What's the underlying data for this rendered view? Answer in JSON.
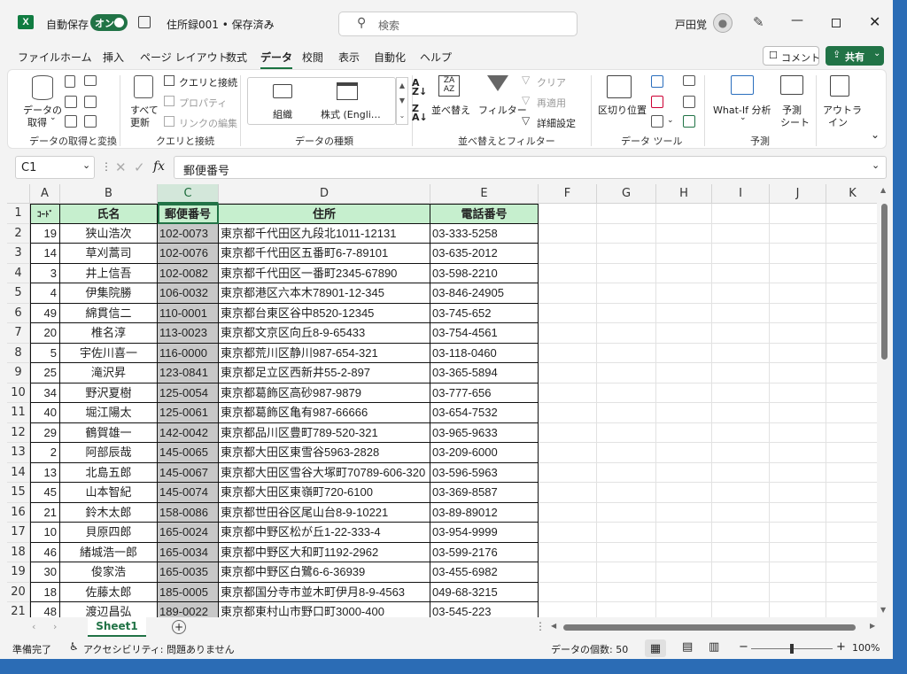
{
  "titlebar": {
    "autosave_label": "自動保存",
    "autosave_state": "オン",
    "filename": "住所録001 • 保存済み",
    "search_placeholder": "検索",
    "user_name": "戸田覚"
  },
  "menu": [
    "ファイル",
    "ホーム",
    "挿入",
    "ページ レイアウト",
    "数式",
    "データ",
    "校閲",
    "表示",
    "自動化",
    "ヘルプ"
  ],
  "menu_active": "データ",
  "comment_label": "コメント",
  "share_label": "共有",
  "ribbon": {
    "get_data": {
      "line1": "データの",
      "line2": "取得"
    },
    "refresh_all": {
      "line1": "すべて",
      "line2": "更新"
    },
    "queries_connections": "クエリと接続",
    "properties": "プロパティ",
    "edit_links": "リンクの編集",
    "org": "組織",
    "stocks": "株式 (Engli…",
    "sort_label": "並べ替え",
    "filter_label": "フィルター",
    "clear_label": "クリア",
    "reapply_label": "再適用",
    "advanced_label": "詳細設定",
    "text_to_columns": "区切り位置",
    "whatif_label": "What-If 分析",
    "forecast": {
      "line1": "予測",
      "line2": "シート"
    },
    "outline": {
      "line1": "アウトラ",
      "line2": "イン"
    },
    "groups": [
      "データの取得と変換",
      "クエリと接続",
      "データの種類",
      "並べ替えとフィルター",
      "データ ツール",
      "予測"
    ]
  },
  "formula_bar": {
    "name_box": "C1",
    "fx": "fx",
    "content": "郵便番号"
  },
  "columns": [
    "A",
    "B",
    "C",
    "D",
    "E",
    "F",
    "G",
    "H",
    "I",
    "J",
    "K"
  ],
  "selected_column": "C",
  "table": {
    "headers": [
      "ｺｰﾄﾞ",
      "氏名",
      "郵便番号",
      "住所",
      "電話番号"
    ],
    "rows": [
      [
        "19",
        "狭山浩次",
        "102-0073",
        "東京都千代田区九段北1011-12131",
        "03-333-5258"
      ],
      [
        "14",
        "草刈蒿司",
        "102-0076",
        "東京都千代田区五番町6-7-89101",
        "03-635-2012"
      ],
      [
        "3",
        "井上信吾",
        "102-0082",
        "東京都千代田区一番町2345-67890",
        "03-598-2210"
      ],
      [
        "4",
        "伊集院勝",
        "106-0032",
        "東京都港区六本木78901-12-345",
        "03-846-24905"
      ],
      [
        "49",
        "綿貫信二",
        "110-0001",
        "東京都台東区谷中8520-12345",
        "03-745-652"
      ],
      [
        "20",
        "椎名淳",
        "113-0023",
        "東京都文京区向丘8-9-65433",
        "03-754-4561"
      ],
      [
        "5",
        "宇佐川喜一",
        "116-0000",
        "東京都荒川区静川987-654-321",
        "03-118-0460"
      ],
      [
        "25",
        "滝沢昇",
        "123-0841",
        "東京都足立区西新井55-2-897",
        "03-365-5894"
      ],
      [
        "34",
        "野沢夏樹",
        "125-0054",
        "東京都葛飾区高砂987-9879",
        "03-777-656"
      ],
      [
        "40",
        "堀江陽太",
        "125-0061",
        "東京都葛飾区亀有987-66666",
        "03-654-7532"
      ],
      [
        "29",
        "鶴賀雄一",
        "142-0042",
        "東京都品川区豊町789-520-321",
        "03-965-9633"
      ],
      [
        "2",
        "阿部辰哉",
        "145-0065",
        "東京都大田区東雪谷5963-2828",
        "03-209-6000"
      ],
      [
        "13",
        "北島五郎",
        "145-0067",
        "東京都大田区雪谷大塚町70789-606-320",
        "03-596-5963"
      ],
      [
        "45",
        "山本智紀",
        "145-0074",
        "東京都大田区東嶺町720-6100",
        "03-369-8587"
      ],
      [
        "21",
        "鈴木太郎",
        "158-0086",
        "東京都世田谷区尾山台8-9-10221",
        "03-89-89012"
      ],
      [
        "10",
        "貝原四郎",
        "165-0024",
        "東京都中野区松が丘1-22-333-4",
        "03-954-9999"
      ],
      [
        "46",
        "緒城浩一郎",
        "165-0034",
        "東京都中野区大和町1192-2962",
        "03-599-2176"
      ],
      [
        "30",
        "俊家浩",
        "165-0035",
        "東京都中野区白鷺6-6-36939",
        "03-455-6982"
      ],
      [
        "18",
        "佐藤太郎",
        "185-0005",
        "東京都国分寺市並木町伊月8-9-4563",
        "049-68-3215"
      ],
      [
        "48",
        "渡辺昌弘",
        "189-0022",
        "東京都東村山市野口町3000-400",
        "03-545-223"
      ]
    ]
  },
  "sheet_tab": "Sheet1",
  "status": {
    "ready": "準備完了",
    "accessibility": "アクセシビリティ: 問題ありません",
    "count": "データの個数: 50",
    "zoom": "100%"
  },
  "colors": {
    "accent": "#217346",
    "header_fill": "#c6efce",
    "selected_fill": "#c8c8c8"
  }
}
